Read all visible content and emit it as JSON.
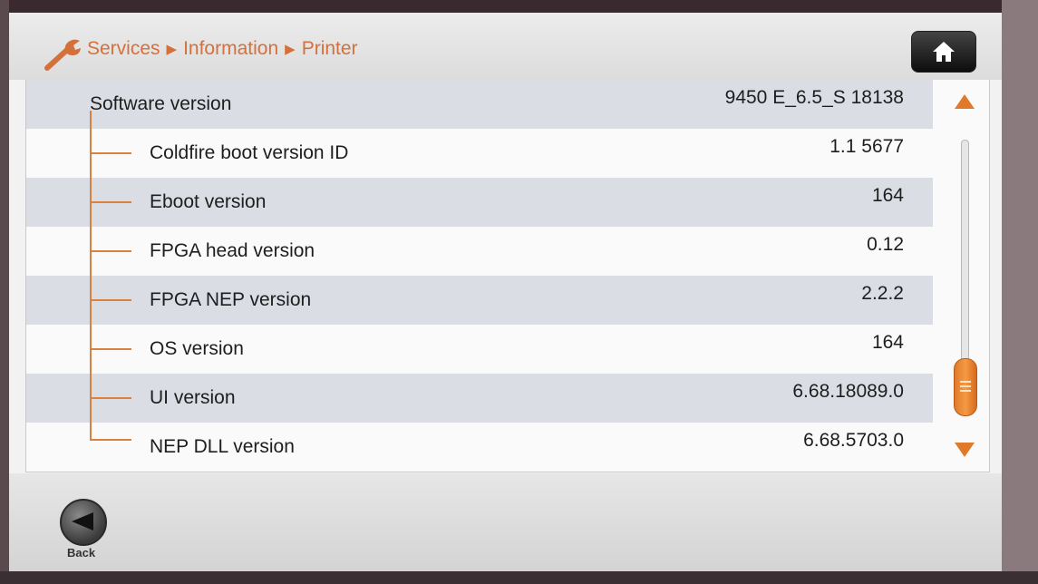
{
  "header": {
    "breadcrumb": [
      "Services",
      "Information",
      "Printer"
    ],
    "separator": "▶",
    "wrench_icon": "wrench-icon",
    "home_icon": "home-icon"
  },
  "rows": [
    {
      "label": "Software version",
      "value": "9450 E_6.5_S 18138"
    },
    {
      "label": "Coldfire boot version ID",
      "value": "1.1 5677"
    },
    {
      "label": "Eboot version",
      "value": "164"
    },
    {
      "label": "FPGA head version",
      "value": "0.12"
    },
    {
      "label": "FPGA NEP version",
      "value": "2.2.2"
    },
    {
      "label": "OS version",
      "value": "164"
    },
    {
      "label": "UI version",
      "value": "6.68.18089.0"
    },
    {
      "label": "NEP DLL version",
      "value": "6.68.5703.0"
    }
  ],
  "scrollbar": {
    "up_icon": "arrow-up-icon",
    "down_icon": "arrow-down-icon"
  },
  "footer": {
    "back_label": "Back",
    "back_icon": "back-arrow-icon"
  },
  "colors": {
    "accent": "#d9823f",
    "row_shade": "#dadde4",
    "breadcrumb": "#d4703b"
  }
}
